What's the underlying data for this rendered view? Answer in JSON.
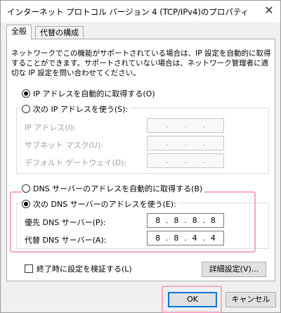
{
  "window": {
    "title": "インターネット プロトコル バージョン 4 (TCP/IPv4)のプロパティ",
    "close_glyph": "✕"
  },
  "tabs": [
    {
      "label": "全般",
      "active": true
    },
    {
      "label": "代替の構成",
      "active": false
    }
  ],
  "description": "ネットワークでこの機能がサポートされている場合は、IP 設定を自動的に取得することができます。サポートされていない場合は、ネットワーク管理者に適切な IP 設定を問い合わせてください。",
  "ip_section": {
    "auto_label": "IP アドレスを自動的に取得する(O)",
    "manual_label": "次の IP アドレスを使う(S):",
    "auto_selected": true,
    "fields": [
      {
        "label": "IP アドレス(I):",
        "value": [
          ".",
          ".",
          "."
        ]
      },
      {
        "label": "サブネット マスク(U):",
        "value": [
          ".",
          ".",
          "."
        ]
      },
      {
        "label": "デフォルト ゲートウェイ(D):",
        "value": [
          ".",
          ".",
          "."
        ]
      }
    ]
  },
  "dns_section": {
    "auto_label": "DNS サーバーのアドレスを自動的に取得する(B)",
    "manual_label": "次の DNS サーバーのアドレスを使う(E):",
    "manual_selected": true,
    "preferred": {
      "label": "優先 DNS サーバー(P):",
      "octets": [
        "8",
        "8",
        "8",
        "8"
      ]
    },
    "alternate": {
      "label": "代替 DNS サーバー(A):",
      "octets": [
        "8",
        "8",
        "4",
        "4"
      ]
    }
  },
  "validate_label": "終了時に設定を検証する(L)",
  "advanced_button": "詳細設定(V)...",
  "ok_button": "OK",
  "cancel_button": "キャンセル",
  "highlight_color": "#f4a8c8"
}
